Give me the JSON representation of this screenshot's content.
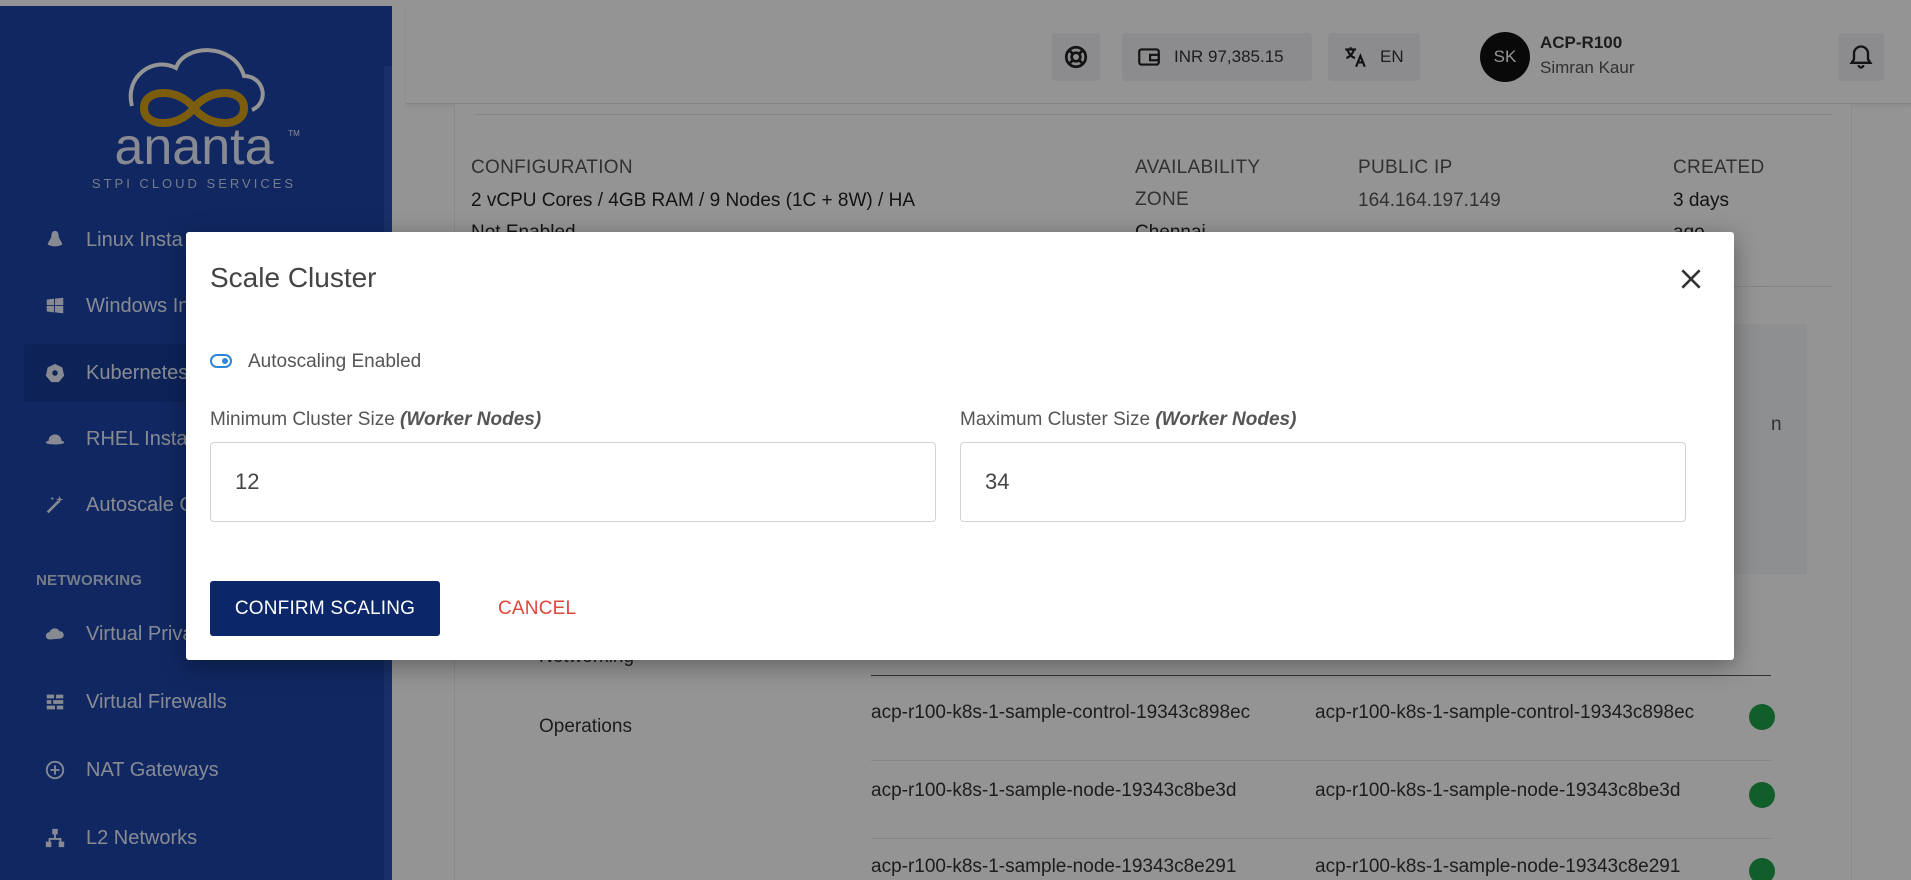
{
  "brand": {
    "name": "ananta",
    "tagline": "STPI CLOUD SERVICES",
    "tm": "TM"
  },
  "sidebar": {
    "items": [
      {
        "label": "Linux Insta",
        "icon": "linux-icon"
      },
      {
        "label": "Windows In",
        "icon": "windows-icon"
      },
      {
        "label": "Kubernetes",
        "icon": "kubernetes-icon",
        "active": true
      },
      {
        "label": "RHEL Insta",
        "icon": "redhat-icon"
      },
      {
        "label": "Autoscale G",
        "icon": "magic-wand-icon"
      }
    ],
    "section": "NETWORKING",
    "networking": [
      {
        "label": "Virtual Priva",
        "icon": "cloud-lock-icon"
      },
      {
        "label": "Virtual Firewalls",
        "icon": "firewall-icon"
      },
      {
        "label": "NAT Gateways",
        "icon": "nat-icon"
      },
      {
        "label": "L2 Networks",
        "icon": "network-icon"
      }
    ]
  },
  "topbar": {
    "balance": "INR 97,385.15",
    "language": "EN",
    "avatar_initials": "SK",
    "account_id": "ACP-R100",
    "user_name": "Simran Kaur"
  },
  "details": {
    "configuration_label": "CONFIGURATION",
    "configuration_value": "2 vCPU Cores / 4GB RAM / 9 Nodes (1C + 8W) / HA",
    "configuration_value_2": "Not Enabled",
    "availability_label": "AVAILABILITY",
    "availability_label_2": "ZONE",
    "availability_value": "Chennai",
    "public_ip_label": "PUBLIC IP",
    "public_ip_value": "164.164.197.149",
    "created_label": "CREATED",
    "created_value": "3 days",
    "created_value_2": "ago",
    "side_text": "n"
  },
  "tabs": {
    "networking": "Networking",
    "operations": "Operations"
  },
  "nodes": [
    {
      "name": "acp-r100-k8s-1-sample-control-19343c898ec",
      "hostname": "acp-r100-k8s-1-sample-control-19343c898ec"
    },
    {
      "name": "acp-r100-k8s-1-sample-node-19343c8be3d",
      "hostname": "acp-r100-k8s-1-sample-node-19343c8be3d"
    },
    {
      "name": "acp-r100-k8s-1-sample-node-19343c8e291",
      "hostname": "acp-r100-k8s-1-sample-node-19343c8e291"
    }
  ],
  "modal": {
    "title": "Scale Cluster",
    "toggle_label": "Autoscaling Enabled",
    "min_label": "Minimum Cluster Size",
    "max_label": "Maximum Cluster Size",
    "label_suffix": "(Worker Nodes)",
    "min_value": "12",
    "max_value": "34",
    "confirm": "CONFIRM SCALING",
    "cancel": "CANCEL"
  },
  "colors": {
    "sidebar": "#1c44a8",
    "primary_button": "#0b2769",
    "cancel": "#e0453a",
    "toggle": "#2d86d6",
    "status_ok": "#1fa34a"
  }
}
